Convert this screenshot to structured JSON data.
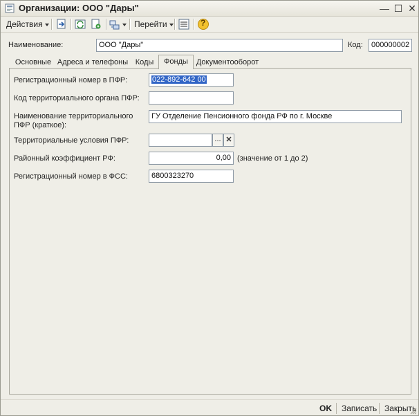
{
  "window": {
    "title": "Организации: ООО \"Дары\"",
    "controls": {
      "minimize": "—",
      "maximize": "☐",
      "close": "✕"
    }
  },
  "toolbar": {
    "actions_label": "Действия",
    "goto_label": "Перейти",
    "help_glyph": "?"
  },
  "header": {
    "name_label": "Наименование:",
    "name_value": "ООО \"Дары\"",
    "code_label": "Код:",
    "code_value": "000000002"
  },
  "tabs": [
    {
      "label": "Основные",
      "active": false
    },
    {
      "label": "Адреса и телефоны",
      "active": false
    },
    {
      "label": "Коды",
      "active": false
    },
    {
      "label": "Фонды",
      "active": true
    },
    {
      "label": "Документооборот",
      "active": false
    }
  ],
  "form": {
    "pfr_reg_label": "Регистрационный номер в ПФР:",
    "pfr_reg_value": "022-892-642 00",
    "pfr_org_code_label": "Код территориального органа ПФР:",
    "pfr_org_code_value": "",
    "pfr_org_name_label_line1": "Наименование территориального",
    "pfr_org_name_label_line2": "ПФР (краткое):",
    "pfr_org_name_value": "ГУ Отделение Пенсионного фонда РФ по г. Москве",
    "terr_cond_label": "Территориальные условия ПФР:",
    "terr_cond_value": "",
    "terr_cond_select_glyph": "...",
    "terr_cond_clear_glyph": "✕",
    "district_coef_label": "Районный коэффициент РФ:",
    "district_coef_value": "0,00",
    "district_coef_hint": "(значение от 1 до 2)",
    "fss_reg_label": "Регистрационный номер в  ФСС:",
    "fss_reg_value": "6800323270"
  },
  "footer": {
    "ok_label": "OK",
    "save_label": "Записать",
    "close_label": "Закрыть"
  }
}
